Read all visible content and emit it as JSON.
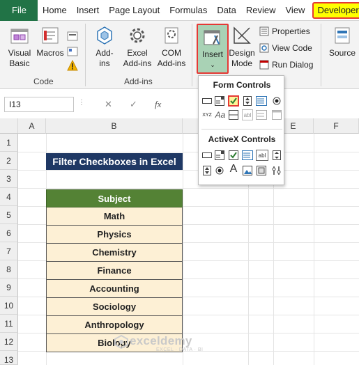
{
  "ribbon_tabs": [
    "File",
    "Home",
    "Insert",
    "Page Layout",
    "Formulas",
    "Data",
    "Review",
    "View",
    "Developer"
  ],
  "ribbon": {
    "code": {
      "label": "Code",
      "visual_basic": [
        "Visual",
        "Basic"
      ],
      "macros": "Macros"
    },
    "addins": {
      "label": "Add-ins",
      "addins_btn": [
        "Add-",
        "ins"
      ],
      "excel_addins": [
        "Excel",
        "Add-ins"
      ],
      "com_addins": [
        "COM",
        "Add-ins"
      ]
    },
    "controls": {
      "insert": "Insert",
      "design_mode": [
        "Design",
        "Mode"
      ],
      "properties": "Properties",
      "view_code": "View Code",
      "run_dialog": "Run Dialog"
    },
    "xml": {
      "source": "Source"
    }
  },
  "dropdown": {
    "form_controls_title": "Form Controls",
    "activex_controls_title": "ActiveX Controls",
    "aa_label": "Aa",
    "xyz_label": "XYZ",
    "abl_label": "abl",
    "a_label": "A"
  },
  "formula_bar": {
    "name_box": "I13",
    "cancel": "✕",
    "enter": "✓",
    "fx": "fx"
  },
  "columns": [
    "A",
    "B",
    "C",
    "D",
    "E",
    "F"
  ],
  "rows": [
    "1",
    "2",
    "3",
    "4",
    "5",
    "6",
    "7",
    "8",
    "9",
    "10",
    "11",
    "12",
    "13"
  ],
  "sheet": {
    "title": "Filter Checkboxes in Excel",
    "header": "Subject",
    "subjects": [
      "Math",
      "Physics",
      "Chemistry",
      "Finance",
      "Accounting",
      "Sociology",
      "Anthropology",
      "Biology"
    ]
  },
  "watermark": {
    "name": "exceldemy",
    "tagline": "EXCEL · DATA · BI"
  },
  "colors": {
    "file_tab": "#217346",
    "developer_highlight": "#ffff00",
    "annotation_red": "#e53935",
    "title_fill": "#1f3864",
    "header_fill": "#548235",
    "row_fill": "#fdf0d5"
  }
}
